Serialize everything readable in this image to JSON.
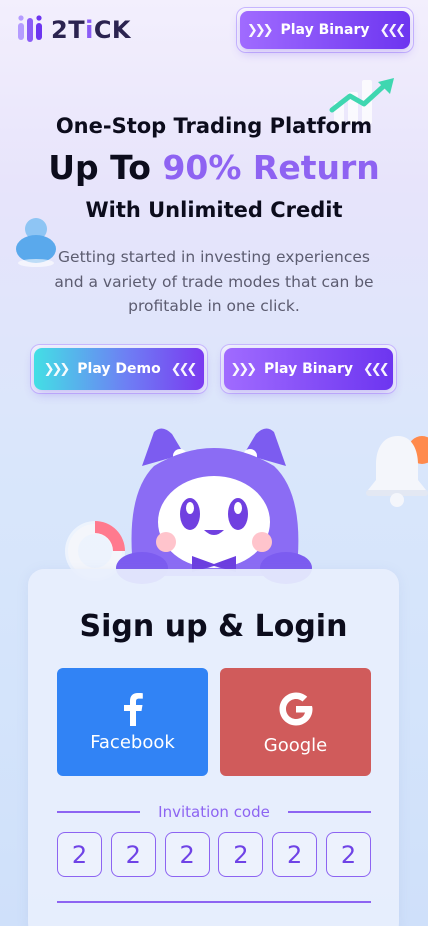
{
  "header": {
    "brand": "2TiCK",
    "brand_prefix": "2T",
    "brand_accent": "i",
    "brand_suffix": "CK",
    "cta_label": "Play Binary"
  },
  "hero": {
    "line1": "One-Stop Trading Platform",
    "line2_prefix": "Up To ",
    "line2_highlight": "90% Return",
    "line3": "With Unlimited Credit",
    "description": "Getting started in investing experiences and a variety of trade modes that can be profitable in one click."
  },
  "buttons": {
    "demo_label": "Play Demo",
    "binary_label": "Play Binary"
  },
  "auth": {
    "title": "Sign up & Login",
    "facebook_label": "Facebook",
    "google_label": "Google",
    "invitation_label": "Invitation code",
    "code_digits": [
      "2",
      "2",
      "2",
      "2",
      "2",
      "2"
    ]
  },
  "colors": {
    "accent": "#8e63f2",
    "facebook": "#3183f5",
    "google": "#d05b5b"
  },
  "icons": [
    "logo-icon",
    "double-chevron-right-icon",
    "double-chevron-left-icon",
    "facebook-icon",
    "google-icon",
    "mascot-illustration",
    "growth-chart-icon",
    "user-icon",
    "bell-icon",
    "pie-chart-icon"
  ]
}
